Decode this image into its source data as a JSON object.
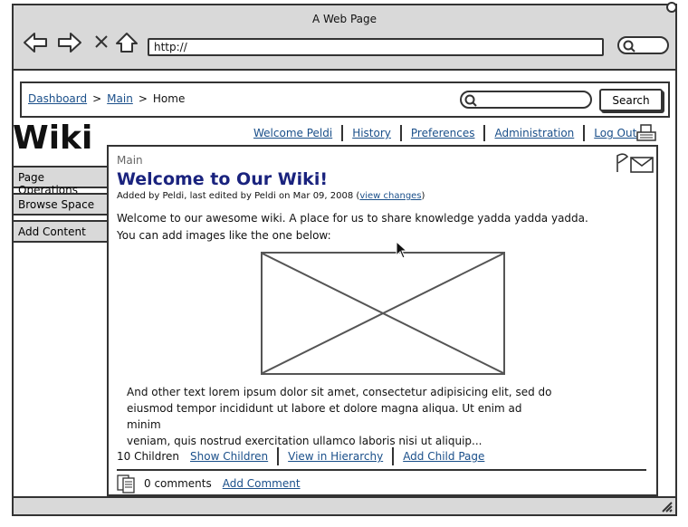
{
  "window": {
    "title": "A Web Page",
    "url": "http://"
  },
  "breadcrumb": {
    "items": [
      "Dashboard",
      "Main"
    ],
    "current": "Home"
  },
  "search": {
    "button_label": "Search",
    "placeholder": ""
  },
  "site": {
    "title": "Wiki"
  },
  "user_links": [
    "Welcome Peldi",
    "History",
    "Preferences",
    "Administration",
    "Log Out"
  ],
  "sidebar": {
    "items": [
      "Page Operations",
      "Browse Space",
      "Add Content"
    ]
  },
  "page": {
    "parent": "Main",
    "title": "Welcome to Our Wiki!",
    "meta_prefix": "Added by Peldi, last edited by Peldi on Mar 09, 2008 (",
    "meta_link": "view changes",
    "meta_suffix": ")",
    "intro_line1": "Welcome to our awesome wiki. A place for us to share knowledge yadda yadda yadda.",
    "intro_line2": "You can add images like the one below:",
    "body_line1": "And other text lorem ipsum dolor sit amet, consectetur adipisicing elit, sed do",
    "body_line2": "eiusmod tempor incididunt ut labore et dolore magna aliqua. Ut enim ad minim",
    "body_line3": "veniam, quis nostrud exercitation ullamco laboris nisi ut aliquip..."
  },
  "children": {
    "count_label": "10 Children",
    "links": [
      "Show Children",
      "View in Hierarchy",
      "Add Child Page"
    ]
  },
  "comments": {
    "count_label": "0 comments",
    "add_label": "Add Comment"
  },
  "colors": {
    "link": "#1a4f8a",
    "title": "#1a237e",
    "chrome": "#d9d9d9"
  }
}
